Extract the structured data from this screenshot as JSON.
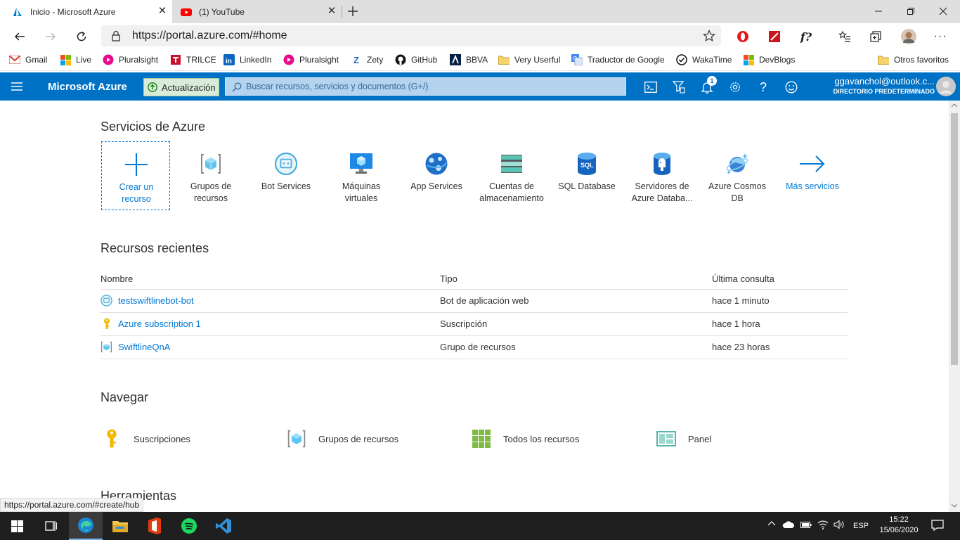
{
  "browser": {
    "tabs": [
      {
        "title": "Inicio - Microsoft Azure",
        "active": true
      },
      {
        "title": "(1) YouTube",
        "active": false
      }
    ],
    "url": "https://portal.azure.com/#home",
    "bookmarks": [
      "Gmail",
      "Live",
      "Pluralsight",
      "TRILCE",
      "LinkedIn",
      "Pluralsight",
      "Zety",
      "GitHub",
      "BBVA",
      "Very Userful",
      "Traductor de Google",
      "WakaTime",
      "DevBlogs"
    ],
    "other_favorites": "Otros favoritos",
    "status_url": "https://portal.azure.com/#create/hub"
  },
  "azure": {
    "brand": "Microsoft Azure",
    "update_label": "Actualización",
    "search_placeholder": "Buscar recursos, servicios y documentos (G+/)",
    "notification_count": "1",
    "account_email": "ggavanchol@outlook.c...",
    "account_directory": "DIRECTORIO PREDETERMINADO"
  },
  "services": {
    "title": "Servicios de Azure",
    "items": [
      {
        "line1": "Crear un",
        "line2": "recurso",
        "icon": "plus-icon"
      },
      {
        "line1": "Grupos de",
        "line2": "recursos",
        "icon": "resource-group-icon"
      },
      {
        "line1": "Bot Services",
        "line2": "",
        "icon": "bot-icon"
      },
      {
        "line1": "Máquinas",
        "line2": "virtuales",
        "icon": "vm-icon"
      },
      {
        "line1": "App Services",
        "line2": "",
        "icon": "app-services-icon"
      },
      {
        "line1": "Cuentas de",
        "line2": "almacenamiento",
        "icon": "storage-icon"
      },
      {
        "line1": "SQL Database",
        "line2": "",
        "icon": "sql-icon"
      },
      {
        "line1": "Servidores de",
        "line2": "Azure Databa...",
        "icon": "postgres-icon"
      },
      {
        "line1": "Azure Cosmos",
        "line2": "DB",
        "icon": "cosmos-icon"
      },
      {
        "line1": "Más servicios",
        "line2": "",
        "icon": "arrow-right-icon"
      }
    ]
  },
  "recent": {
    "title": "Recursos recientes",
    "columns": [
      "Nombre",
      "Tipo",
      "Última consulta"
    ],
    "rows": [
      {
        "name": "testswiftlinebot-bot",
        "type": "Bot de aplicación web",
        "last": "hace 1 minuto",
        "icon": "bot-icon"
      },
      {
        "name": "Azure subscription 1",
        "type": "Suscripción",
        "last": "hace 1 hora",
        "icon": "key-icon"
      },
      {
        "name": "SwiftlineQnA",
        "type": "Grupo de recursos",
        "last": "hace 23 horas",
        "icon": "resource-group-icon"
      }
    ]
  },
  "navigate": {
    "title": "Navegar",
    "items": [
      {
        "label": "Suscripciones",
        "icon": "key-icon"
      },
      {
        "label": "Grupos de recursos",
        "icon": "resource-group-icon"
      },
      {
        "label": "Todos los recursos",
        "icon": "grid-icon"
      },
      {
        "label": "Panel",
        "icon": "dashboard-icon"
      }
    ]
  },
  "tools": {
    "title": "Herramientas"
  },
  "taskbar": {
    "lang": "ESP",
    "time": "15:22",
    "date": "15/06/2020"
  }
}
